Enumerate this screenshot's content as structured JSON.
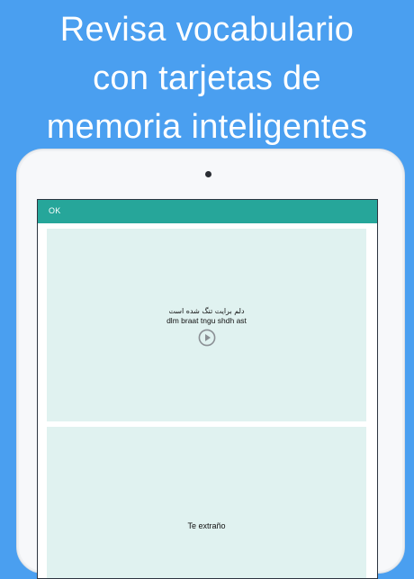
{
  "headline": {
    "line1": "Revisa vocabulario",
    "line2": "con tarjetas de",
    "line3": "memoria inteligentes"
  },
  "app": {
    "ok_label": "OK",
    "accent_color": "#26a69a",
    "card_color": "#e0f2f0"
  },
  "card_front": {
    "native_text": "دلم برایت تنگ شده است",
    "transliteration": "dlm braat tngu shdh ast",
    "play_icon": "play-circle-icon"
  },
  "card_back": {
    "translation": "Te extraño"
  }
}
